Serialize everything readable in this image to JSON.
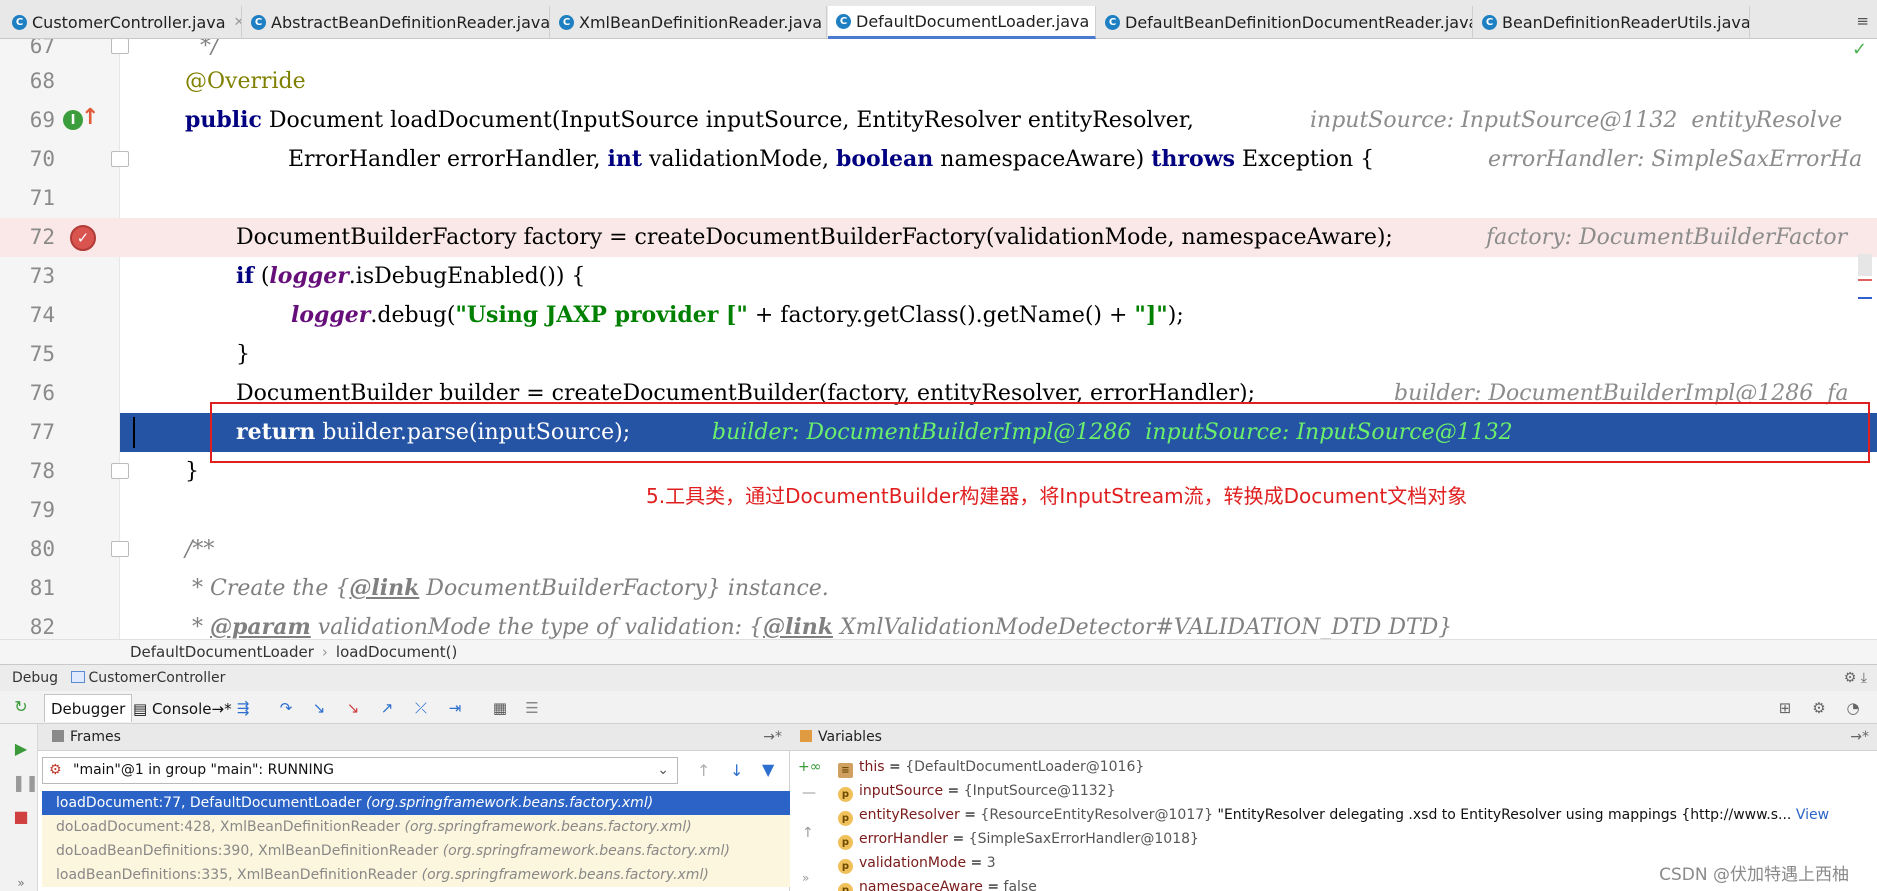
{
  "tabs": [
    {
      "label": "CustomerController.java",
      "active": false
    },
    {
      "label": "AbstractBeanDefinitionReader.java",
      "active": false
    },
    {
      "label": "XmlBeanDefinitionReader.java",
      "active": false
    },
    {
      "label": "DefaultDocumentLoader.java",
      "active": true
    },
    {
      "label": "DefaultBeanDefinitionDocumentReader.java",
      "active": false
    },
    {
      "label": "BeanDefinitionReaderUtils.java",
      "active": false
    }
  ],
  "tab_overflow": "≡",
  "editor": {
    "lines": [
      {
        "num": "67",
        "comment_end": "*/"
      },
      {
        "num": "68",
        "annotation": "@Override"
      },
      {
        "num": "69",
        "kw": "public",
        "text": "Document loadDocument(InputSource inputSource, EntityResolver entityResolver,",
        "hint": "inputSource: InputSource@1132  entityResolve"
      },
      {
        "num": "70",
        "p1": "ErrorHandler errorHandler, ",
        "kw1": "int",
        "p2": " validationMode, ",
        "kw2": "boolean",
        "p3": " namespaceAware) ",
        "kw3": "throws",
        "p4": " Exception {",
        "hint": "errorHandler: SimpleSaxErrorHa"
      },
      {
        "num": "71"
      },
      {
        "num": "72",
        "text": "DocumentBuilderFactory factory = createDocumentBuilderFactory(validationMode, namespaceAware);",
        "hint": "factory: DocumentBuilderFactor"
      },
      {
        "num": "73",
        "kw": "if",
        "p1": " (",
        "field": "logger",
        "p2": ".isDebugEnabled()) {"
      },
      {
        "num": "74",
        "field": "logger",
        "p1": ".debug(",
        "s1": "\"Using JAXP provider [\"",
        "p2": " + factory.getClass().getName() + ",
        "s2": "\"]\"",
        "p3": ");"
      },
      {
        "num": "75",
        "text": "}"
      },
      {
        "num": "76",
        "text": "DocumentBuilder builder = createDocumentBuilder(factory, entityResolver, errorHandler);",
        "hint": "builder: DocumentBuilderImpl@1286  fa"
      },
      {
        "num": "77",
        "kw": "return",
        "text": " builder.parse(inputSource);",
        "hint": "builder: DocumentBuilderImpl@1286  inputSource: InputSource@1132"
      },
      {
        "num": "78",
        "text": "}"
      },
      {
        "num": "79"
      },
      {
        "num": "80",
        "comment": "/**"
      },
      {
        "num": "81",
        "c1": " * Create the {",
        "tag": "@link",
        "c2": " DocumentBuilderFactory} instance."
      },
      {
        "num": "82",
        "c1": " * ",
        "tag": "@param",
        "c2": " validationMode the type of validation: {",
        "tag2": "@link",
        "c3": " XmlValidationModeDetector#VALIDATION_DTD DTD}"
      }
    ],
    "annotation_note": "5.工具类，通过DocumentBuilder构建器，将InputStream流，转换成Document文档对象",
    "breakpoint_icon": "breakpoint-check-icon",
    "implements_icon": "implements-method-icon"
  },
  "breadcrumb": {
    "items": [
      "DefaultDocumentLoader",
      "loadDocument()"
    ]
  },
  "debug": {
    "title": "Debug",
    "config": "CustomerController",
    "tabs": [
      "Debugger",
      "Console"
    ],
    "console_suffix": "→*",
    "frames_title": "Frames",
    "variables_title": "Variables",
    "thread": "\"main\"@1 in group \"main\": RUNNING",
    "frames": [
      {
        "method": "loadDocument:77, DefaultDocumentLoader",
        "pkg": "(org.springframework.beans.factory.xml)",
        "selected": true
      },
      {
        "method": "doLoadDocument:428, XmlBeanDefinitionReader",
        "pkg": "(org.springframework.beans.factory.xml)",
        "selected": false
      },
      {
        "method": "doLoadBeanDefinitions:390, XmlBeanDefinitionReader",
        "pkg": "(org.springframework.beans.factory.xml)",
        "selected": false
      },
      {
        "method": "loadBeanDefinitions:335, XmlBeanDefinitionReader",
        "pkg": "(org.springframework.beans.factory.xml)",
        "selected": false
      }
    ],
    "variables": [
      {
        "name": "this",
        "value": "{DefaultDocumentLoader@1016}",
        "icon": "object-icon"
      },
      {
        "name": "inputSource",
        "value": "{InputSource@1132}",
        "icon": "param-icon"
      },
      {
        "name": "entityResolver",
        "value": "{ResourceEntityResolver@1017}",
        "extra": "\"EntityResolver delegating .xsd to EntityResolver using mappings {http://www.s...",
        "view": "View",
        "icon": "param-icon"
      },
      {
        "name": "errorHandler",
        "value": "{SimpleSaxErrorHandler@1018}",
        "icon": "param-icon"
      },
      {
        "name": "validationMode",
        "value": "3",
        "icon": "param-icon"
      },
      {
        "name": "namespaceAware",
        "value": "false",
        "icon": "param-icon"
      }
    ]
  },
  "watermark": "CSDN @伏加特遇上西柚"
}
